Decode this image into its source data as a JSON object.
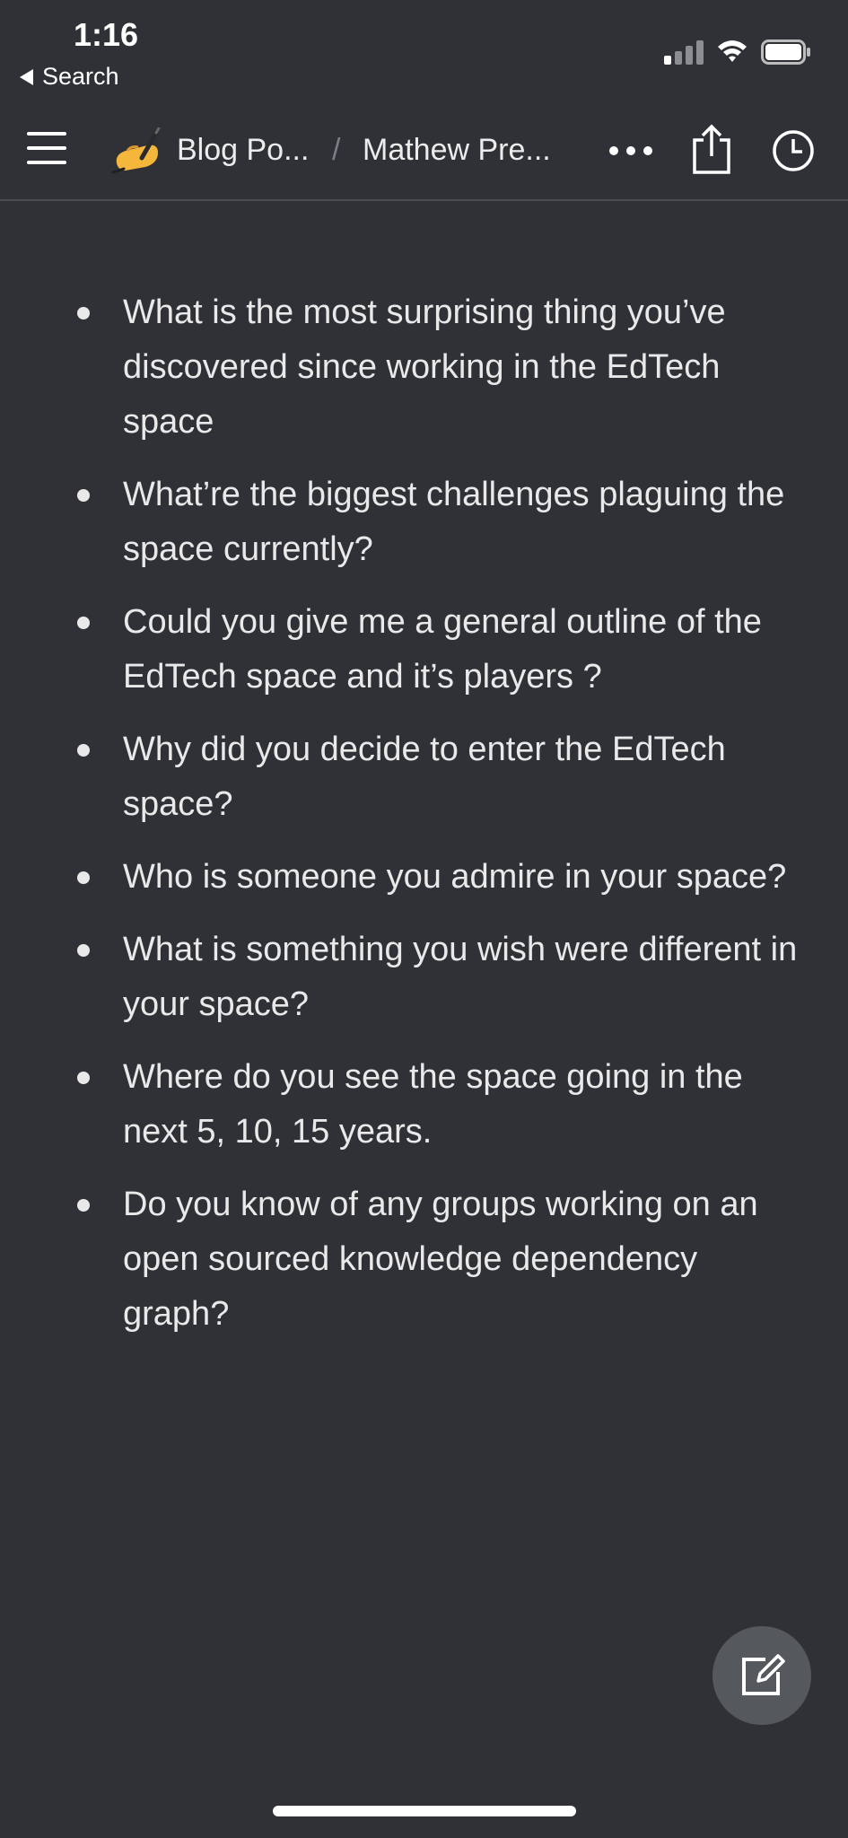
{
  "status_bar": {
    "time": "1:16",
    "back_label": "Search"
  },
  "nav": {
    "page_emoji": "writing-hand",
    "breadcrumb_parent": "Blog Po...",
    "breadcrumb_separator": "/",
    "breadcrumb_current": "Mathew Pre...",
    "icons": [
      "menu-icon",
      "more-icon",
      "share-icon",
      "history-icon"
    ]
  },
  "questions": [
    "What is the most surprising thing you’ve discovered since working in the EdTech space",
    "What’re the biggest challenges plaguing the space currently?",
    "Could you give me a general outline of the EdTech space and it’s players ?",
    "Why did you decide to enter the EdTech space?",
    "Who is someone you admire in your space?",
    "What is something you wish were different in your space?",
    "Where do you see the space going in the next 5, 10, 15 years.",
    "Do you know of any groups working on an open sourced knowledge dependency graph?"
  ],
  "fab": {
    "icon": "edit-icon"
  },
  "colors": {
    "background": "#2f3136",
    "text": "#e9e9e9",
    "fab": "#55585d",
    "divider": "#4a4d52"
  }
}
